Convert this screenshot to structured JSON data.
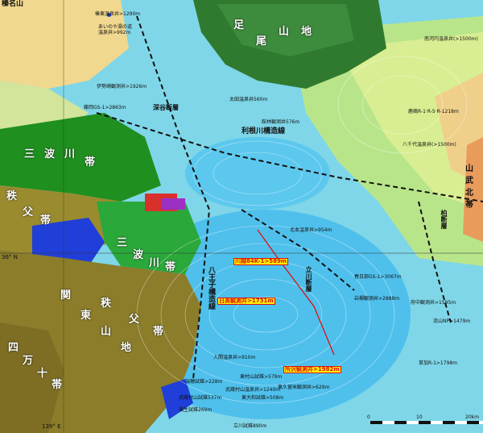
{
  "map": {
    "labels": {
      "northwest_corner": "榛名山",
      "lat_36": "36° N",
      "lon_139": "139° E",
      "scale_ticks": [
        "0",
        "10",
        "20km"
      ]
    },
    "region_names": {
      "ashio": [
        "足",
        "尾",
        "山",
        "地"
      ],
      "sanbagawa_left": [
        "三",
        "波",
        "川",
        "帯"
      ],
      "chichibu_left": [
        "秩",
        "父",
        "帯"
      ],
      "sanbagawa_center": [
        "三",
        "波",
        "川",
        "帯"
      ],
      "kanto": [
        "関",
        "東",
        "山",
        "地"
      ],
      "chichibu_right": [
        "秩",
        "父",
        "帯"
      ],
      "shimanto": [
        "四",
        "万",
        "十",
        "帯"
      ],
      "yamizo": [
        "山",
        "武",
        "北",
        "帯"
      ]
    },
    "faults": {
      "tone_fault": [
        "利",
        "根",
        "川",
        "構",
        "造",
        "線"
      ],
      "hachioji": [
        "八",
        "王",
        "子",
        "構",
        "造",
        "線"
      ],
      "fukaya": [
        "深",
        "谷",
        "断",
        "層"
      ],
      "tachikawa": [
        "立",
        "川",
        "断",
        "層"
      ],
      "kashiwa": [
        "柏",
        "断",
        "層"
      ]
    },
    "wells": [
      {
        "id": "w1",
        "text": "榛東温泉井>1290m"
      },
      {
        "id": "w2",
        "text": "あいのや湯の道\n温泉井>992m"
      },
      {
        "id": "w3",
        "text": "伊勢崎観測井>1926m"
      },
      {
        "id": "w4",
        "text": "藤岡GS-1>2863m"
      },
      {
        "id": "w5",
        "text": "太田温泉井560m"
      },
      {
        "id": "w6",
        "text": "館林観測井576m"
      },
      {
        "id": "w7",
        "text": "南河内温泉井(>1500m)"
      },
      {
        "id": "w8",
        "text": "鹿嶋R-1·R-5·R-1218m"
      },
      {
        "id": "w9",
        "text": "八千代温泉井(>1500m)"
      },
      {
        "id": "w10",
        "text": "北本温泉井>954m"
      },
      {
        "id": "w11",
        "text": "春日部GS-1>3067m"
      },
      {
        "id": "w12",
        "text": "岩槻観測井>2888m"
      },
      {
        "id": "w13",
        "text": "府中観測井>1595m"
      },
      {
        "id": "w14",
        "text": "流山NP>1479m"
      },
      {
        "id": "w15",
        "text": "草加R-1>1798m"
      },
      {
        "id": "w16",
        "text": "入間温泉井>910m"
      },
      {
        "id": "w17",
        "text": "東村山試錐>579m"
      },
      {
        "id": "w18",
        "text": "東久留米観測井>629m"
      },
      {
        "id": "w19",
        "text": "武蔵村山温泉井>1240m"
      },
      {
        "id": "w20",
        "text": "東大和試錐>508m"
      },
      {
        "id": "w21",
        "text": "瑞穂試錐>228m"
      },
      {
        "id": "w22",
        "text": "武蔵村山試錐537m"
      },
      {
        "id": "w23",
        "text": "福生試錐269m"
      },
      {
        "id": "w24",
        "text": "立川試錐890m"
      }
    ],
    "highlighted_wells": {
      "kawagoe": "川越84K-1>589m",
      "hidaka": "日高観測井>1731m",
      "tokorozawa": "所沢観測井>1982m"
    },
    "colors": {
      "water": "#7fd6e8",
      "deep_basin": "#37b2e8",
      "sanbagawa": "#1f8f1f",
      "chichibu": "#9a8b2e",
      "highlight_bg": "#fff200",
      "highlight_text": "#d11"
    }
  }
}
